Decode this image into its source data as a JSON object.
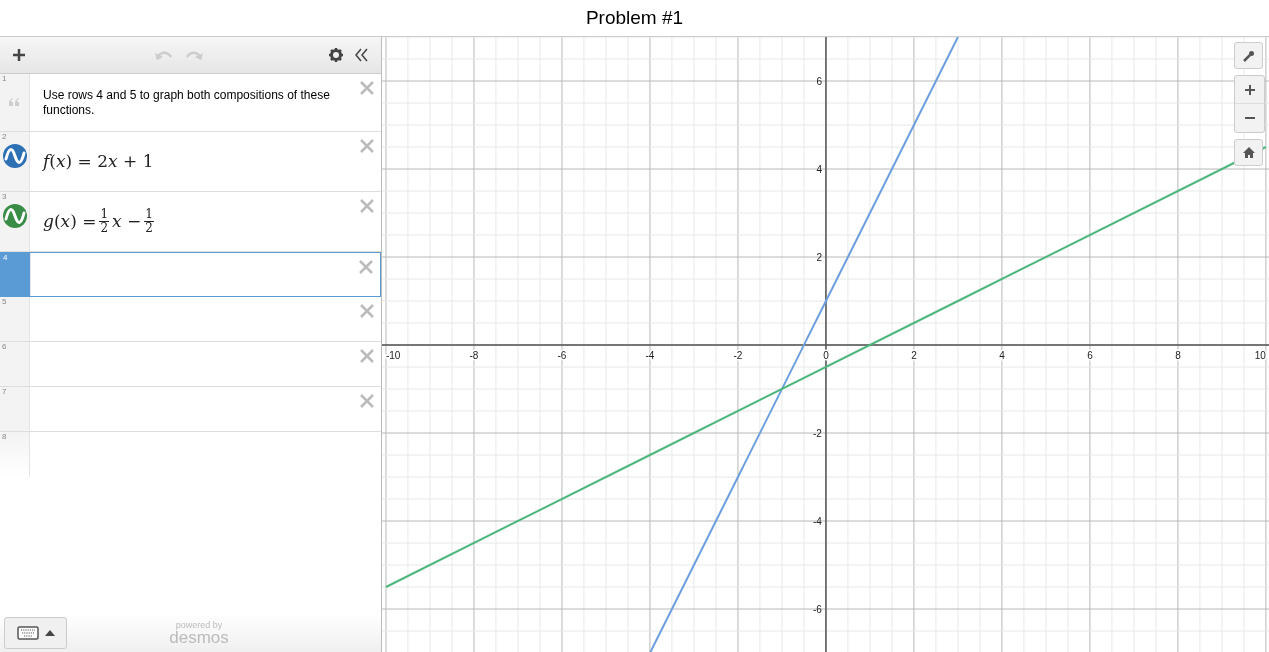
{
  "title": "Problem #1",
  "toolbar": {
    "undo": {
      "disabled": true
    },
    "redo": {
      "disabled": true
    }
  },
  "expressions": [
    {
      "number": "1",
      "kind": "note",
      "text": "Use rows 4 and 5 to graph both compositions of these functions.",
      "selected": false
    },
    {
      "number": "2",
      "kind": "function",
      "color": "#2d70b3",
      "parts": [
        {
          "t": "*f*(*x*) = 2"
        },
        {
          "t": "*x* + 1"
        }
      ],
      "selected": false
    },
    {
      "number": "3",
      "kind": "function",
      "color": "#388c46",
      "parts": [
        {
          "t": "*g*(*x*) = "
        },
        {
          "num": "1",
          "den": "2"
        },
        {
          "t": "*x* − "
        },
        {
          "num": "1",
          "den": "2"
        }
      ],
      "selected": false
    },
    {
      "number": "4",
      "kind": "empty",
      "selected": true
    },
    {
      "number": "5",
      "kind": "empty",
      "selected": false
    },
    {
      "number": "6",
      "kind": "empty",
      "selected": false
    },
    {
      "number": "7",
      "kind": "empty",
      "selected": false
    },
    {
      "number": "8",
      "kind": "new",
      "selected": false
    }
  ],
  "footer": {
    "powered_by": "powered by",
    "brand": "desmos"
  },
  "graph": {
    "chart_data": {
      "type": "line",
      "x": [
        -10,
        -4,
        3,
        10
      ],
      "series": [
        {
          "color": "#6a9fdc",
          "values": [
            null,
            -7,
            7,
            null
          ]
        },
        {
          "color": "#4cb77a",
          "values": [
            -5.5,
            -2.5,
            1,
            4.5
          ]
        }
      ],
      "xlim": [
        -10.09,
        10.07
      ],
      "ylim": [
        -7,
        7
      ],
      "grid": true,
      "xticks": [
        {
          "value": -10,
          "label": "-10"
        },
        {
          "value": -8,
          "label": "-8"
        },
        {
          "value": -6,
          "label": "-6"
        },
        {
          "value": -4,
          "label": "-4"
        },
        {
          "value": -2,
          "label": "-2"
        },
        {
          "value": 0,
          "label": "0"
        },
        {
          "value": 2,
          "label": "2"
        },
        {
          "value": 4,
          "label": "4"
        },
        {
          "value": 6,
          "label": "6"
        },
        {
          "value": 8,
          "label": "8"
        },
        {
          "value": 10,
          "label": "10"
        }
      ],
      "yticks": [
        {
          "value": -6,
          "label": "-6"
        },
        {
          "value": -4,
          "label": "-4"
        },
        {
          "value": -2,
          "label": "-2"
        },
        {
          "value": 2,
          "label": "2"
        },
        {
          "value": 4,
          "label": "4"
        },
        {
          "value": 6,
          "label": "6"
        }
      ]
    }
  }
}
